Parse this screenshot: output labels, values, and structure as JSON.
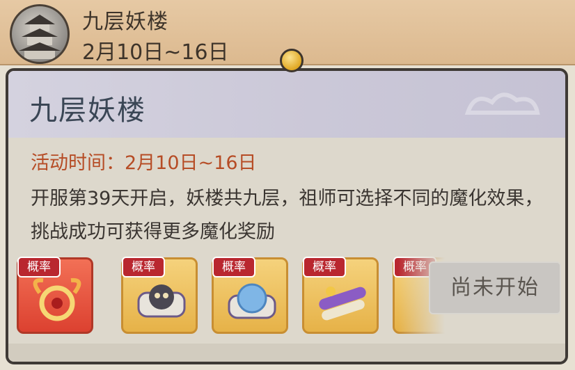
{
  "header": {
    "title": "九层妖楼",
    "date": "2月10日~16日"
  },
  "card": {
    "title": "九层妖楼",
    "event_time": "活动时间：2月10日~16日",
    "description": "开服第39天开启，妖楼共九层，祖师可选择不同的魔化效果，挑战成功可获得更多魔化奖励",
    "rewards": [
      {
        "badge": "概率",
        "icon": "phoenix-ring-icon",
        "rarity": "red"
      },
      {
        "badge": "概率",
        "icon": "skull-scroll-icon",
        "rarity": "gold"
      },
      {
        "badge": "概率",
        "icon": "blue-orb-scroll-icon",
        "rarity": "gold"
      },
      {
        "badge": "概率",
        "icon": "purple-scroll-icon",
        "rarity": "gold"
      },
      {
        "badge": "概率",
        "icon": "hidden-item-icon",
        "rarity": "gold"
      }
    ],
    "action_button": "尚未开始"
  },
  "colors": {
    "time_accent": "#b64c25",
    "badge_red": "#b9272f",
    "title_blue": "#3a4655"
  }
}
